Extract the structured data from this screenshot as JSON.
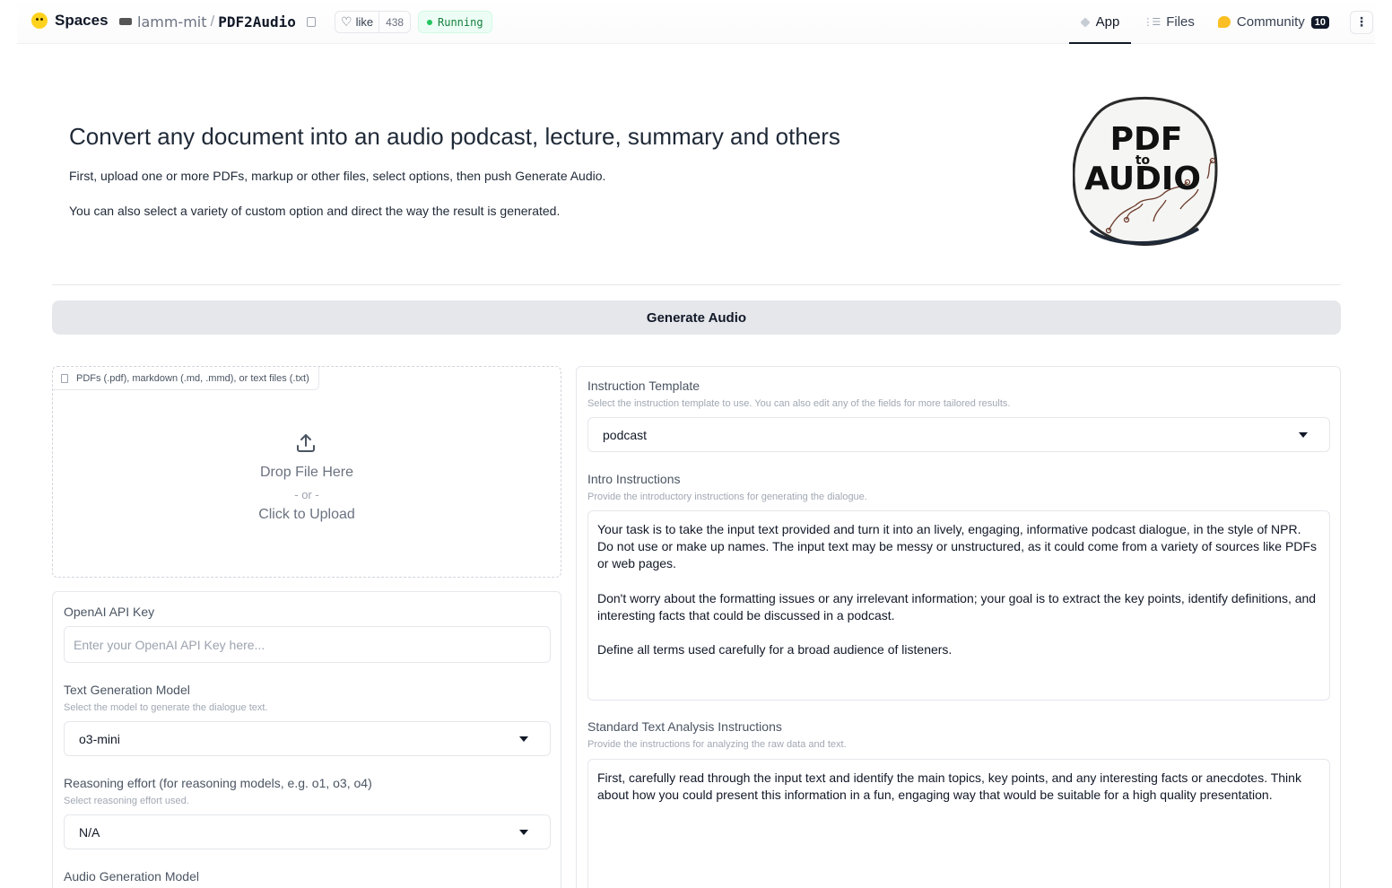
{
  "topbar": {
    "brand": "Spaces",
    "org": "lamm-mit",
    "separator": "/",
    "project": "PDF2Audio",
    "like_label": "like",
    "like_count": "438",
    "status": "Running",
    "tabs": [
      {
        "label": "App",
        "icon": "cube-icon",
        "active": true
      },
      {
        "label": "Files",
        "icon": "files-icon",
        "active": false
      },
      {
        "label": "Community",
        "icon": "community-icon",
        "active": false,
        "badge": "10"
      }
    ]
  },
  "header": {
    "title": "Convert any document into an audio podcast, lecture, summary and others",
    "line1": "First, upload one or more PDFs, markup or other files, select options, then push Generate Audio.",
    "line2": "You can also select a variety of custom option and direct the way the result is generated.",
    "logo_text_top": "PDF",
    "logo_text_mid": "to",
    "logo_text_bottom": "AUDIO"
  },
  "generate_button": "Generate Audio",
  "upload": {
    "label": "PDFs (.pdf), markdown (.md, .mmd), or text files (.txt)",
    "drop": "Drop File Here",
    "or": "- or -",
    "click": "Click to Upload"
  },
  "settings": {
    "api_key": {
      "label": "OpenAI API Key",
      "placeholder": "Enter your OpenAI API Key here..."
    },
    "text_model": {
      "label": "Text Generation Model",
      "info": "Select the model to generate the dialogue text.",
      "value": "o3-mini"
    },
    "reasoning": {
      "label": "Reasoning effort (for reasoning models, e.g. o1, o3, o4)",
      "info": "Select reasoning effort used.",
      "value": "N/A"
    },
    "audio_model": {
      "label": "Audio Generation Model"
    }
  },
  "instructions": {
    "template": {
      "label": "Instruction Template",
      "info": "Select the instruction template to use. You can also edit any of the fields for more tailored results.",
      "value": "podcast"
    },
    "intro": {
      "label": "Intro Instructions",
      "info": "Provide the introductory instructions for generating the dialogue.",
      "value": "Your task is to take the input text provided and turn it into an lively, engaging, informative podcast dialogue, in the style of NPR. Do not use or make up names. The input text may be messy or unstructured, as it could come from a variety of sources like PDFs or web pages.\n\nDon't worry about the formatting issues or any irrelevant information; your goal is to extract the key points, identify definitions, and interesting facts that could be discussed in a podcast.\n\nDefine all terms used carefully for a broad audience of listeners."
    },
    "analysis": {
      "label": "Standard Text Analysis Instructions",
      "info": "Provide the instructions for analyzing the raw data and text.",
      "value": "First, carefully read through the input text and identify the main topics, key points, and any interesting facts or anecdotes. Think about how you could present this information in a fun, engaging way that would be suitable for a high quality presentation."
    }
  }
}
